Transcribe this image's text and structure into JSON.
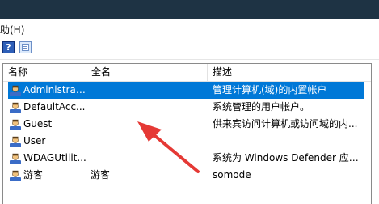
{
  "menubar": {
    "help_label": "助(H)"
  },
  "toolbar": {
    "help_icon_glyph": "?"
  },
  "table": {
    "columns": [
      "名称",
      "全名",
      "描述"
    ],
    "rows": [
      {
        "name": "Administrat...",
        "fullname": "",
        "description": "管理计算机(域)的内置帐户",
        "selected": true
      },
      {
        "name": "DefaultAcc...",
        "fullname": "",
        "description": "系统管理的用户帐户。",
        "selected": false
      },
      {
        "name": "Guest",
        "fullname": "",
        "description": "供来宾访问计算机或访问域的内...",
        "selected": false
      },
      {
        "name": "User",
        "fullname": "",
        "description": "",
        "selected": false
      },
      {
        "name": "WDAGUtilit...",
        "fullname": "",
        "description": "系统为 Windows Defender 应用...",
        "selected": false
      },
      {
        "name": "游客",
        "fullname": "游客",
        "description": "somode",
        "selected": false
      }
    ]
  },
  "colors": {
    "selection": "#0078d7",
    "annotation_arrow": "#e53935",
    "titlebar": "#1e3344"
  },
  "icons": {
    "row_icon": "user-account-icon",
    "toolbar": [
      "help-icon",
      "properties-icon"
    ]
  }
}
